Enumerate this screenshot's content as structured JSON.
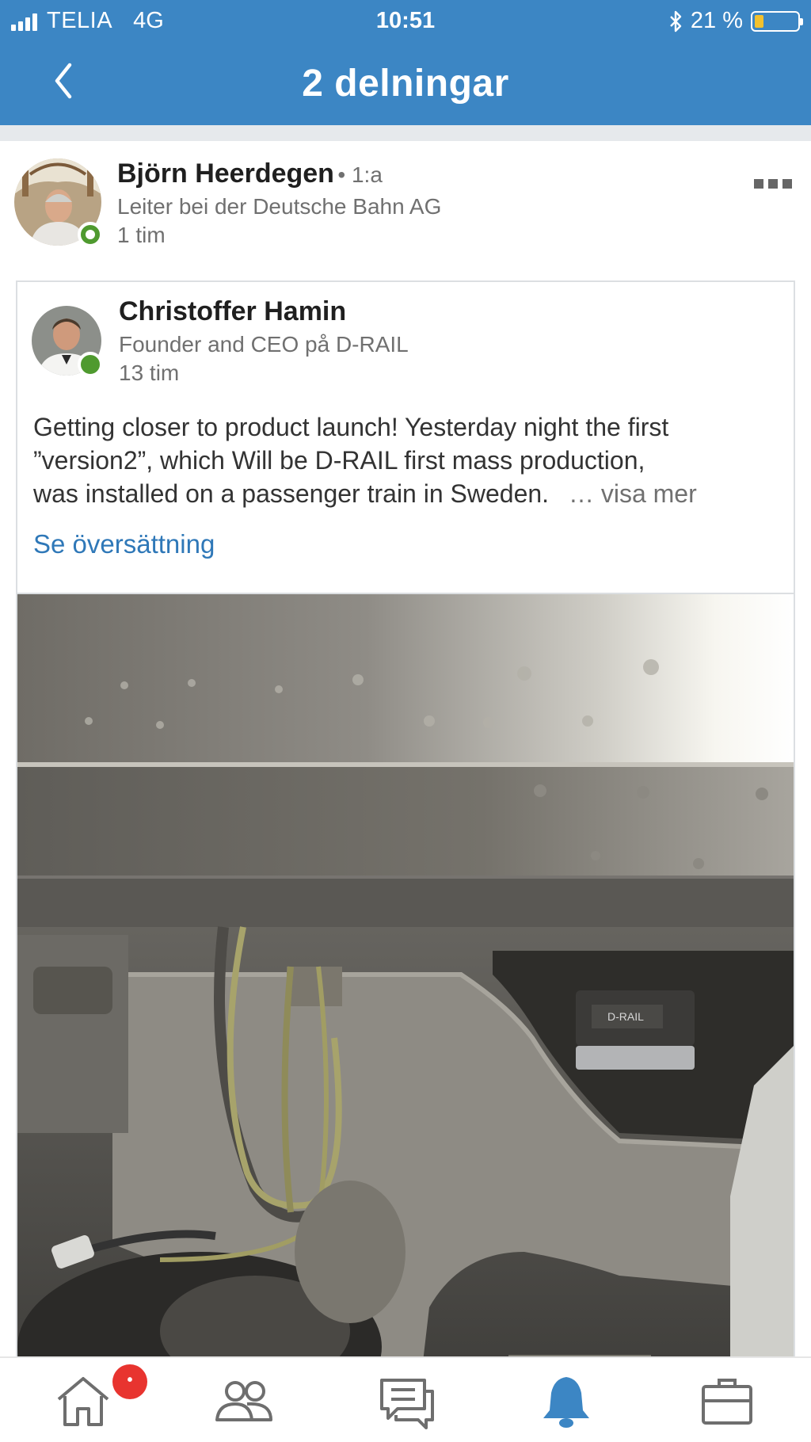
{
  "status_bar": {
    "carrier": "TELIA",
    "network": "4G",
    "time": "10:51",
    "battery_text": "21 %",
    "battery_level": 0.21
  },
  "header": {
    "title": "2 delningar"
  },
  "sharer": {
    "name": "Björn Heerdegen",
    "degree": "• 1:a",
    "headline": "Leiter bei der Deutsche Bahn AG",
    "time": "1 tim"
  },
  "post": {
    "author": "Christoffer Hamin",
    "headline": "Founder and CEO på D-RAIL",
    "time": "13 tim",
    "text_line1": "Getting closer to product launch! Yesterday night the first",
    "text_line2": "”version2”, which Will be D-RAIL first mass production,",
    "text_line3": "was installed on a passenger train in Sweden.",
    "see_more": "… visa mer",
    "translate": "Se översättning",
    "image_device_label": "D-RAIL"
  },
  "tabbar": {
    "notification_badge": "•",
    "active_tab": "notifications"
  },
  "colors": {
    "brand_blue": "#3c86c4",
    "link_blue": "#2f78b8",
    "online_green": "#4f9a2f",
    "badge_red": "#e8342f"
  }
}
